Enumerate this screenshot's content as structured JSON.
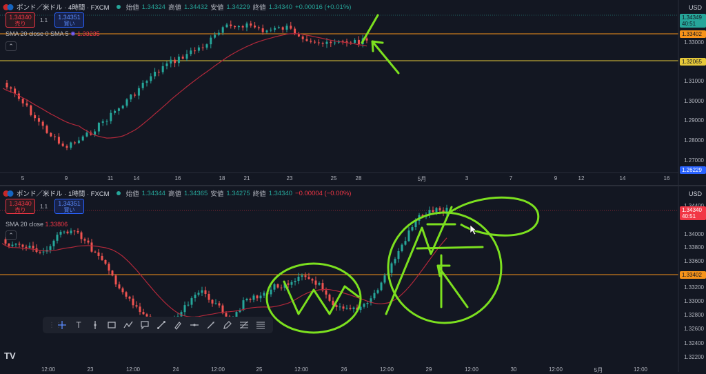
{
  "top": {
    "symbol": "ポンド／米ドル · 4時間 · FXCM",
    "ohlc": {
      "open_label": "始値",
      "open": "1.34324",
      "high_label": "高値",
      "high": "1.34432",
      "low_label": "安値",
      "low": "1.34229",
      "close_label": "終値",
      "close": "1.34340",
      "change": "+0.00016 (+0.01%)"
    },
    "sell_price": "1.34340",
    "sell_label": "売り",
    "spread": "1.1",
    "buy_price": "1.34351",
    "buy_label": "買い",
    "sma_label": "SMA 20 close 0 SMA 5",
    "sma_value": "1.33235",
    "currency": "USD",
    "price_axis": [
      "1.33000",
      "1.32000",
      "1.31000",
      "1.30000",
      "1.29000",
      "1.28000",
      "1.27000"
    ],
    "tags": {
      "last": "1.34349",
      "countdown": "40:51",
      "orange": "1.33402",
      "yellow": "1.32065",
      "blue": "1.26229"
    },
    "time_axis": [
      "5",
      "9",
      "11",
      "14",
      "16",
      "18",
      "21",
      "23",
      "25",
      "28",
      "5月",
      "3",
      "7",
      "9",
      "12",
      "14",
      "16"
    ]
  },
  "bottom": {
    "symbol": "ポンド／米ドル · 1時間 · FXCM",
    "ohlc": {
      "open_label": "始値",
      "open": "1.34344",
      "high_label": "高値",
      "high": "1.34365",
      "low_label": "安値",
      "low": "1.34275",
      "close_label": "終値",
      "close": "1.34340",
      "change": "−0.00004 (−0.00%)"
    },
    "sell_price": "1.34340",
    "sell_label": "売り",
    "spread": "1.1",
    "buy_price": "1.34351",
    "buy_label": "買い",
    "sma_label": "SMA 20 close",
    "sma_value": "1.33806",
    "currency": "USD",
    "price_axis": [
      "1.34400",
      "1.34000",
      "1.33800",
      "1.33600",
      "1.33200",
      "1.33000",
      "1.32800",
      "1.32600",
      "1.32400",
      "1.32200"
    ],
    "tags": {
      "last": "1.34340",
      "countdown": "40:51",
      "orange": "1.33402"
    },
    "time_axis": [
      "12:00",
      "23",
      "12:00",
      "24",
      "12:00",
      "25",
      "12:00",
      "26",
      "12:00",
      "29",
      "12:00",
      "30",
      "12:00",
      "5月",
      "12:00"
    ]
  },
  "toolbar": {
    "tools": [
      "crosshair-icon",
      "text-icon",
      "vertical-line-icon",
      "rectangle-icon",
      "path-icon",
      "callout-icon",
      "trend-line-icon",
      "brush-icon",
      "horizontal-line-icon",
      "ray-icon",
      "pen-icon",
      "fib-icon",
      "parallel-channel-icon"
    ],
    "text_tool_label": "T"
  },
  "logo": "TV",
  "colors": {
    "bg": "#131722",
    "up": "#26a69a",
    "down": "#ef5350",
    "sma": "#b2283a",
    "orange": "#f7931a",
    "yellow": "#e6c93a",
    "blue": "#2962ff",
    "annotation": "#7ce01f"
  }
}
